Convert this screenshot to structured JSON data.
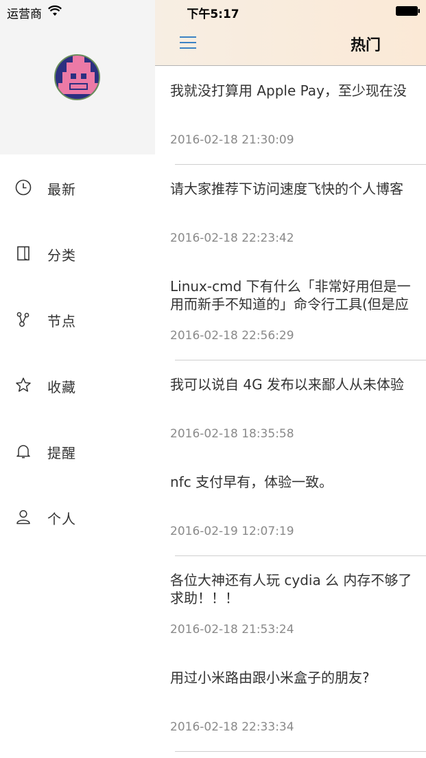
{
  "status_bar": {
    "carrier": "运营商",
    "time": "下午5:17"
  },
  "drawer": {
    "menu": [
      {
        "label": "最新",
        "icon": "clock-icon"
      },
      {
        "label": "分类",
        "icon": "book-icon"
      },
      {
        "label": "节点",
        "icon": "node-branch-icon"
      },
      {
        "label": "收藏",
        "icon": "star-icon"
      },
      {
        "label": "提醒",
        "icon": "bell-icon"
      },
      {
        "label": "个人",
        "icon": "person-icon"
      }
    ]
  },
  "nav": {
    "title": "热门"
  },
  "topics": [
    {
      "title": "我就没打算用 Apple Pay，至少现在没",
      "time": "2016-02-18 21:30:09"
    },
    {
      "title": "请大家推荐下访问速度飞快的个人博客",
      "time": "2016-02-18 22:23:42"
    },
    {
      "title": "Linux-cmd 下有什么「非常好用但是一\n用而新手不知道的」命令行工具(但是应",
      "time": "2016-02-18 22:56:29"
    },
    {
      "title": "我可以说自 4G 发布以来鄙人从未体验",
      "time": "2016-02-18 18:35:58"
    },
    {
      "title": "nfc 支付早有，体验一致。",
      "time": "2016-02-19 12:07:19"
    },
    {
      "title": "各位大神还有人玩 cydia 么 内存不够了\n求助！！！",
      "time": "2016-02-18 21:53:24"
    },
    {
      "title": "用过小米路由跟小米盒子的朋友?",
      "time": "2016-02-18 22:33:34"
    }
  ],
  "colors": {
    "accent": "#3b82c4",
    "nav_background": "#f9ecdd",
    "text": "#333333",
    "muted": "#8a8a8a"
  }
}
